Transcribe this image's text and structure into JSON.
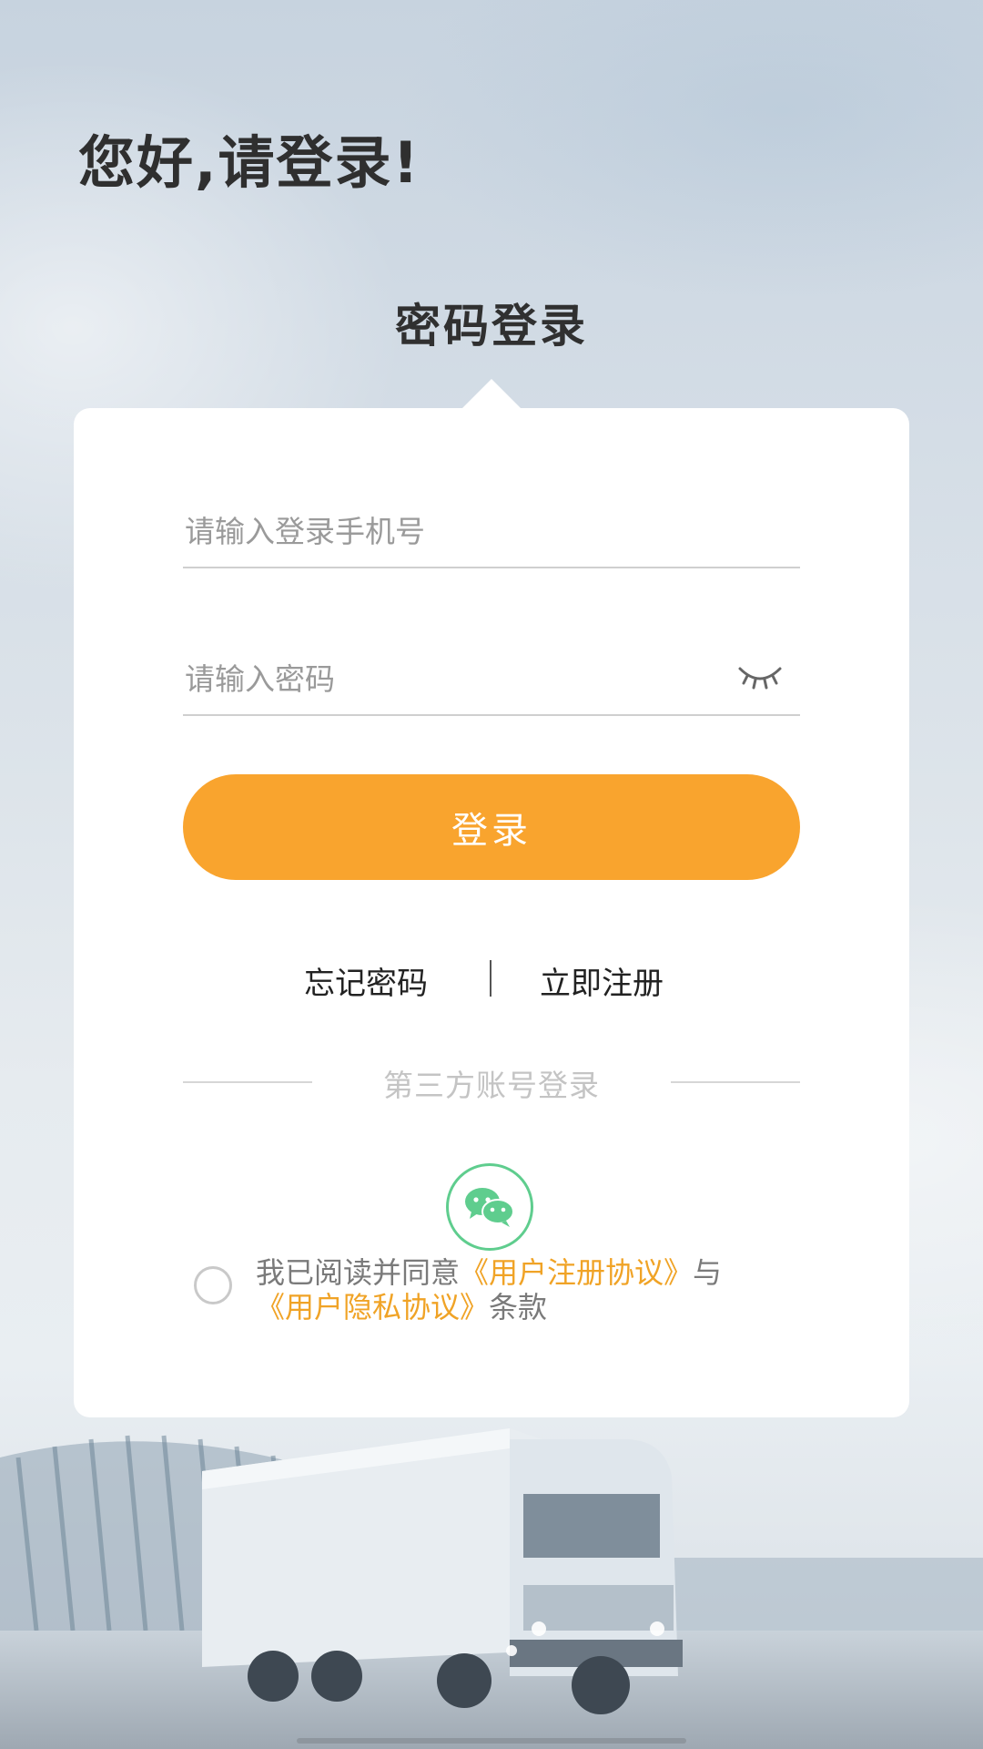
{
  "header": {
    "greeting": "您好,请登录!",
    "tab_title": "密码登录"
  },
  "form": {
    "phone_placeholder": "请输入登录手机号",
    "password_placeholder": "请输入密码",
    "password_visibility_icon": "eye-closed-icon",
    "login_label": "登录"
  },
  "links": {
    "forgot_password": "忘记密码",
    "separator": "|",
    "register_now": "立即注册"
  },
  "third_party": {
    "label": "第三方账号登录",
    "wechat_icon": "wechat-icon"
  },
  "agreement": {
    "prefix": "我已阅读并同意",
    "user_agreement": "《用户注册协议》",
    "conjunction": "与",
    "privacy_agreement": "《用户隐私协议》",
    "suffix": "条款"
  },
  "colors": {
    "accent": "#f9a42e",
    "link_orange": "#f0a326",
    "wechat_green": "#5fcd8e"
  }
}
